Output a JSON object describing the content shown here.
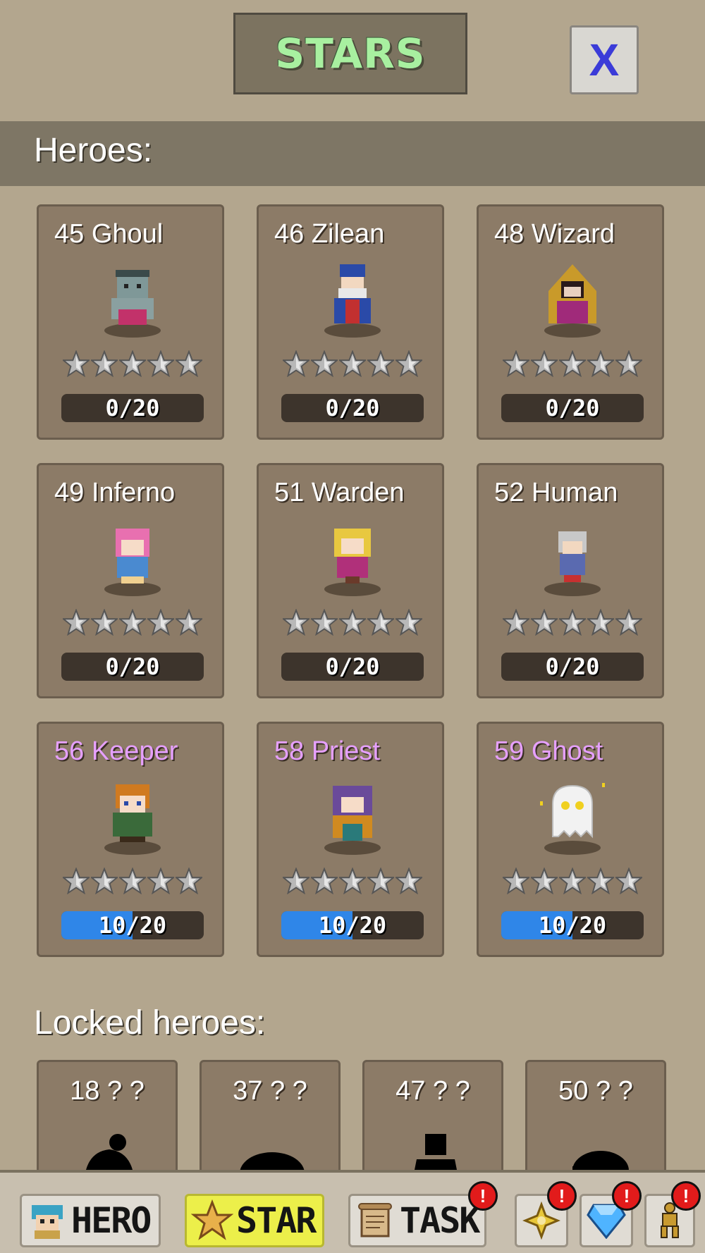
{
  "header": {
    "title": "STARS",
    "close_label": "X"
  },
  "heroes_section": {
    "title": "Heroes:"
  },
  "heroes": [
    {
      "name": "45 Ghoul",
      "progress": "0/20",
      "fill": 0,
      "stars": 5,
      "name_color": "white",
      "portrait": "ghoul-portrait"
    },
    {
      "name": "46 Zilean",
      "progress": "0/20",
      "fill": 0,
      "stars": 5,
      "name_color": "white",
      "portrait": "zilean-portrait"
    },
    {
      "name": "48 Wizard",
      "progress": "0/20",
      "fill": 0,
      "stars": 5,
      "name_color": "white",
      "portrait": "wizard-portrait"
    },
    {
      "name": "49 Inferno",
      "progress": "0/20",
      "fill": 0,
      "stars": 5,
      "name_color": "white",
      "portrait": "inferno-portrait"
    },
    {
      "name": "51 Warden",
      "progress": "0/20",
      "fill": 0,
      "stars": 5,
      "name_color": "white",
      "portrait": "warden-portrait"
    },
    {
      "name": "52 Human",
      "progress": "0/20",
      "fill": 0,
      "stars": 5,
      "name_color": "white",
      "portrait": "human-portrait"
    },
    {
      "name": "56 Keeper",
      "progress": "10/20",
      "fill": 0.5,
      "stars": 5,
      "name_color": "purple",
      "portrait": "keeper-portrait"
    },
    {
      "name": "58 Priest",
      "progress": "10/20",
      "fill": 0.5,
      "stars": 5,
      "name_color": "purple",
      "portrait": "priest-portrait"
    },
    {
      "name": "59 Ghost",
      "progress": "10/20",
      "fill": 0.5,
      "stars": 5,
      "name_color": "purple",
      "portrait": "ghost-portrait"
    }
  ],
  "locked_section": {
    "title": "Locked heroes:"
  },
  "locked_heroes": [
    {
      "name": "18 ? ?"
    },
    {
      "name": "37 ? ?"
    },
    {
      "name": "47 ? ?"
    },
    {
      "name": "50 ? ?"
    }
  ],
  "nav": {
    "hero_label": "HERO",
    "star_label": "STAR",
    "task_label": "TASK",
    "badge_text": "!",
    "icons": [
      "hero-portrait-icon",
      "star-icon",
      "scroll-icon",
      "cross-emblem-icon",
      "diamond-icon",
      "trophy-figure-icon"
    ]
  },
  "colors": {
    "progress_fill": "#2f86e8",
    "purple_name": "#e6a0ff",
    "title_green": "#a8f0a0",
    "badge_red": "#e21b1b"
  }
}
